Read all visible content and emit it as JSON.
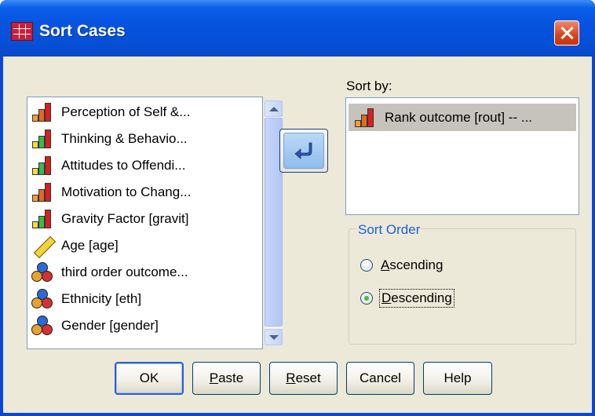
{
  "window": {
    "title": "Sort Cases",
    "title_icon": "sort-cases-icon",
    "close_icon": "close-icon"
  },
  "variables": [
    {
      "label": "Perception of Self &...",
      "icon": "rank-bars-icon"
    },
    {
      "label": "Thinking & Behavio...",
      "icon": "rank-bars-green-icon"
    },
    {
      "label": "Attitudes to Offendi...",
      "icon": "rank-bars-green-icon"
    },
    {
      "label": "Motivation to Chang...",
      "icon": "rank-bars-icon"
    },
    {
      "label": "Gravity Factor [gravit]",
      "icon": "rank-bars-green-icon"
    },
    {
      "label": "Age [age]",
      "icon": "ruler-icon"
    },
    {
      "label": "third order outcome...",
      "icon": "nominal-balls-icon"
    },
    {
      "label": "Ethnicity [eth]",
      "icon": "nominal-balls-icon"
    },
    {
      "label": "Gender [gender]",
      "icon": "nominal-balls-icon"
    }
  ],
  "sort_by": {
    "label": "Sort by:",
    "items": [
      {
        "label": "Rank outcome [rout] -- ...",
        "icon": "rank-bars-icon"
      }
    ]
  },
  "sort_order": {
    "legend": "Sort Order",
    "options": [
      {
        "label_pre": "",
        "label_ul": "A",
        "label_post": "scending",
        "checked": false
      },
      {
        "label_pre": "",
        "label_ul": "D",
        "label_post": "escending",
        "checked": true
      }
    ]
  },
  "buttons": {
    "ok": {
      "pre": "OK",
      "ul": "",
      "post": ""
    },
    "paste": {
      "pre": "",
      "ul": "P",
      "post": "aste"
    },
    "reset": {
      "pre": "",
      "ul": "R",
      "post": "eset"
    },
    "cancel": {
      "pre": "Cancel",
      "ul": "",
      "post": ""
    },
    "help": {
      "pre": "Help",
      "ul": "",
      "post": ""
    }
  },
  "colors": {
    "titlebar": "#0654e0",
    "dialog_bg": "#ece9d8",
    "selection": "#c5c3bc",
    "legend": "#1d5ed8"
  }
}
